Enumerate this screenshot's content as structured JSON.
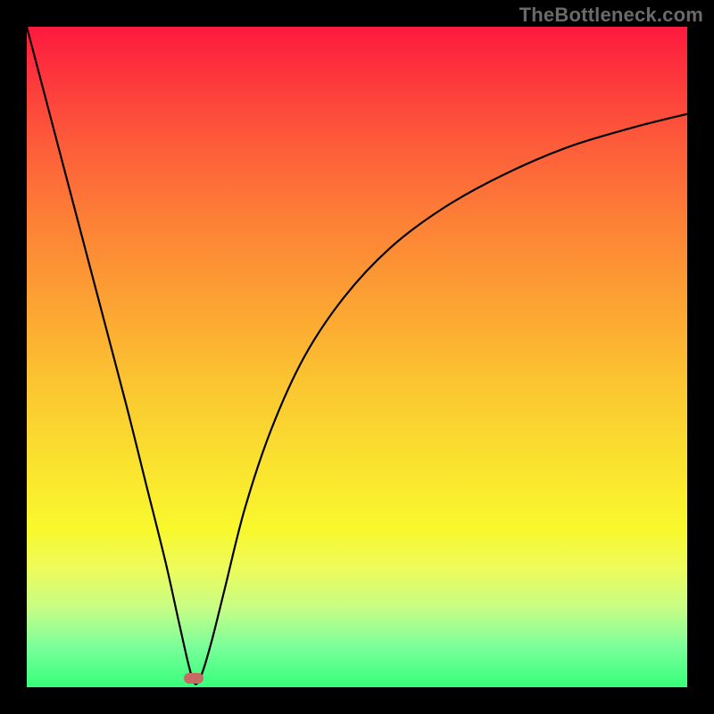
{
  "watermark": "TheBottleneck.com",
  "chart_data": {
    "type": "line",
    "title": "",
    "xlabel": "",
    "ylabel": "",
    "xlim": [
      0,
      100
    ],
    "ylim": [
      0,
      100
    ],
    "series": [
      {
        "name": "curve",
        "x": [
          0,
          5,
          10,
          15,
          18,
          21,
          23,
          24.6,
          25.5,
          26.5,
          28,
          30,
          33,
          37,
          42,
          48,
          55,
          63,
          72,
          82,
          92,
          100
        ],
        "values": [
          100,
          81,
          62,
          43,
          31,
          19,
          10,
          3,
          0.5,
          2,
          7,
          15,
          27,
          39,
          50,
          59,
          66.5,
          72.5,
          77.5,
          81.8,
          84.8,
          86.8
        ]
      }
    ],
    "marker": {
      "x": 25.3,
      "y": 1.4
    },
    "gradient_stops": [
      {
        "pos": 0,
        "color": "#fd1a3f"
      },
      {
        "pos": 100,
        "color": "#36ff7a"
      }
    ]
  }
}
